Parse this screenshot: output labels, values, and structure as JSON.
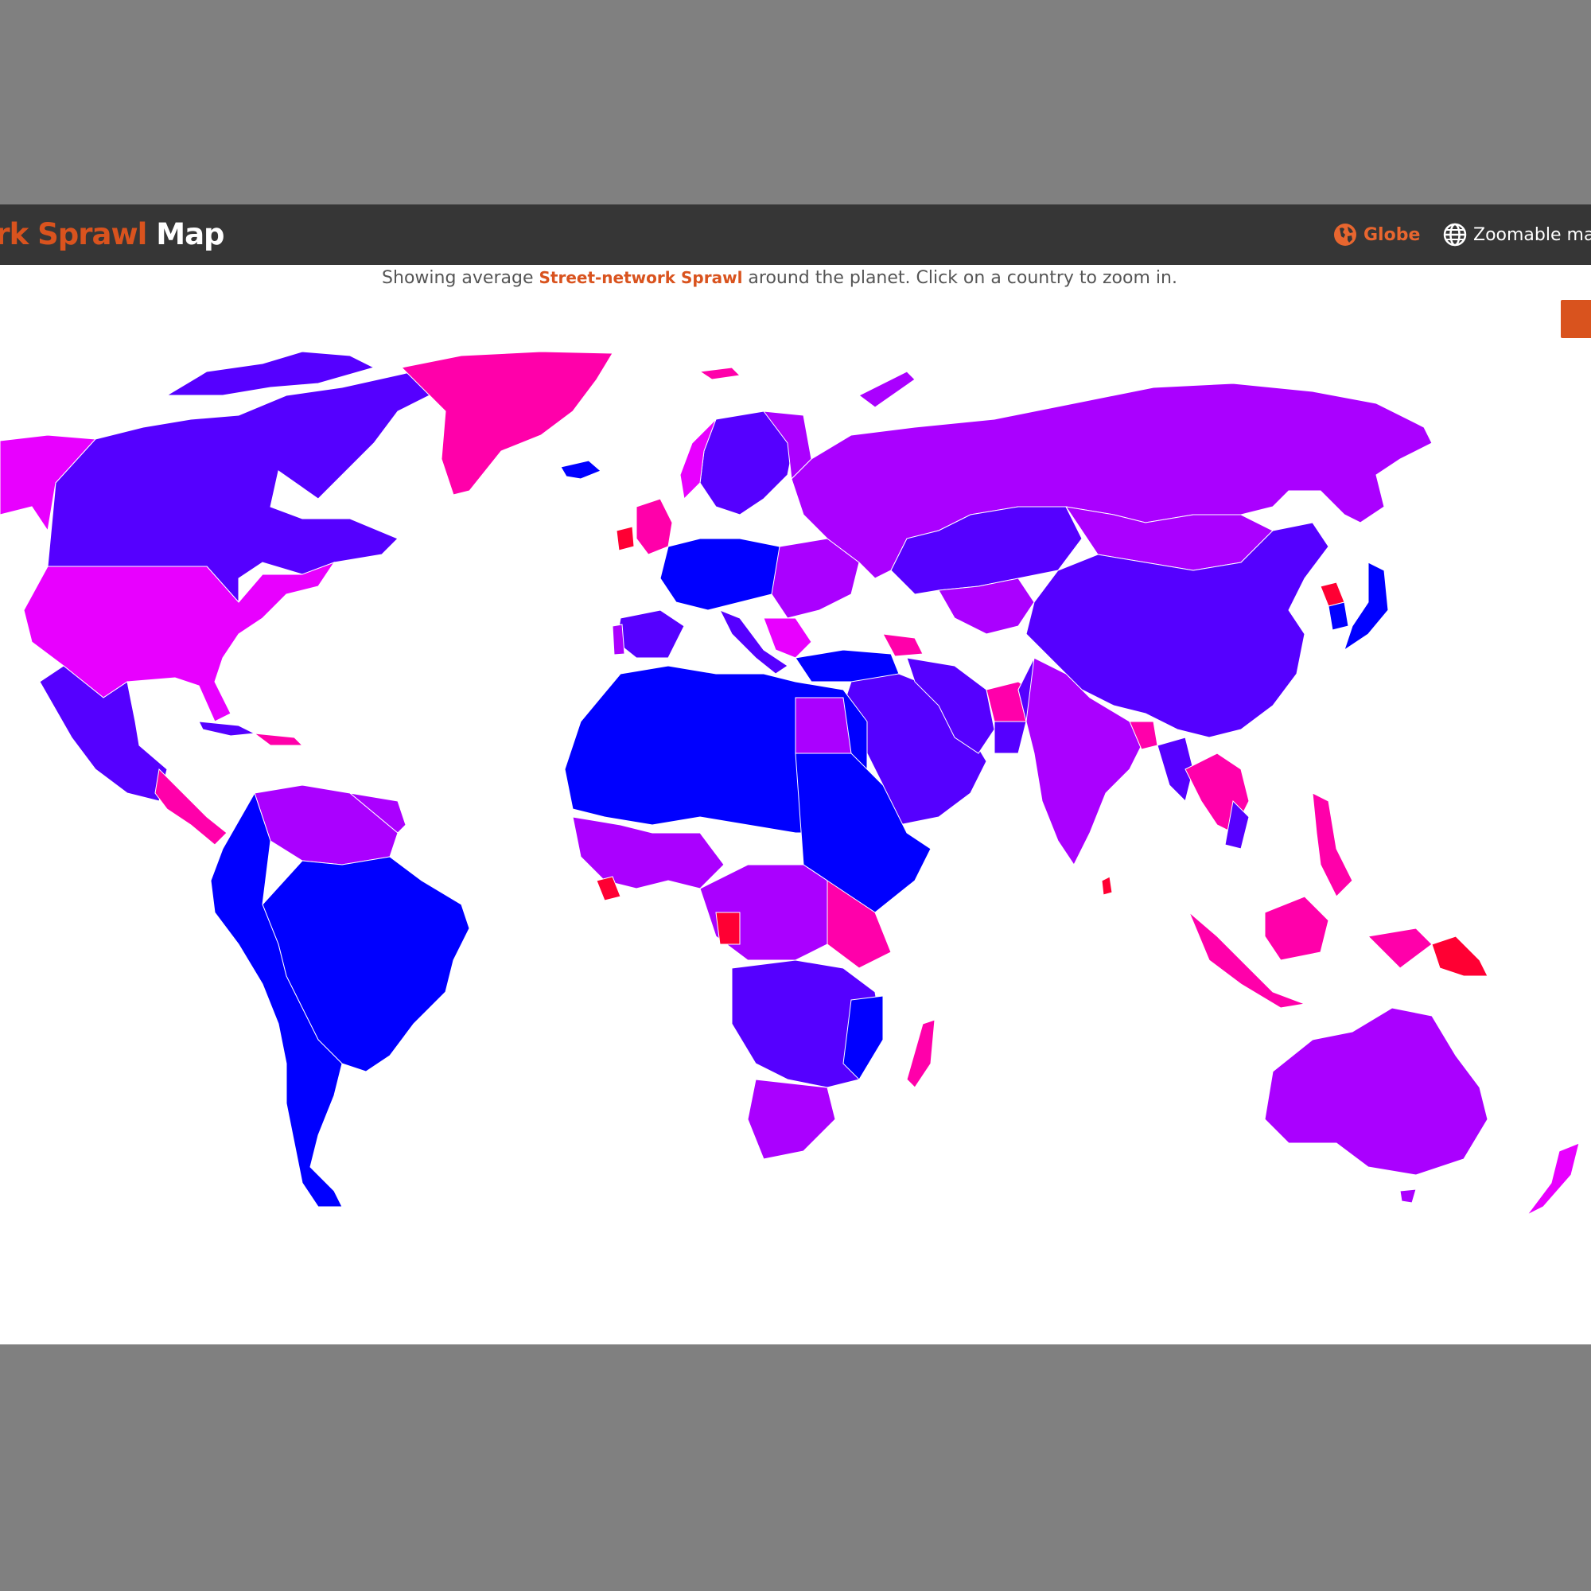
{
  "header": {
    "title_accent": "ork Sprawl",
    "title_plain": "Map",
    "nav": {
      "globe_label": "Globe",
      "zoomable_label": "Zoomable ma"
    }
  },
  "subtitle": {
    "prefix": "Showing average ",
    "metric": "Street-network Sprawl",
    "suffix": " around the planet. Click on a country to zoom in."
  },
  "colors": {
    "page_background": "#808080",
    "navbar": "#363636",
    "accent": "#d9531e",
    "scale_low": "#0000ff",
    "scale_low_mid": "#5500ff",
    "scale_mid": "#aa00ff",
    "scale_high_mid": "#e800ff",
    "scale_high": "#ff00aa",
    "scale_max": "#ff0033"
  },
  "icons": {
    "globe_link": "globe-americas-icon",
    "zoomable_link": "globe-grid-icon"
  }
}
